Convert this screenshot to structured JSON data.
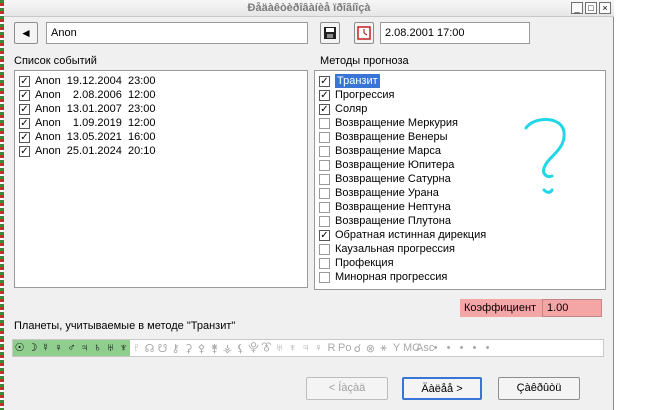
{
  "window": {
    "title": "Ðåäàêòèðîâàíèå ïðîãíîçà",
    "minimize": "_",
    "maximize": "□",
    "close": "×"
  },
  "toolbar": {
    "arrow_glyph": "◄",
    "name_value": "Anon",
    "datetime_value": "2.08.2001    17:00"
  },
  "events": {
    "label": "Список событий",
    "items": [
      {
        "text": "Anon  19.12.2004  23:00",
        "checked": true
      },
      {
        "text": "Anon    2.08.2006  12:00",
        "checked": true
      },
      {
        "text": "Anon  13.01.2007  23:00",
        "checked": true
      },
      {
        "text": "Anon    1.09.2019  12:00",
        "checked": true
      },
      {
        "text": "Anon  13.05.2021  16:00",
        "checked": true
      },
      {
        "text": "Anon  25.01.2024  20:10",
        "checked": true
      }
    ]
  },
  "methods": {
    "label": "Методы прогноза",
    "items": [
      {
        "text": "Транзит",
        "checked": true,
        "selected": true
      },
      {
        "text": "Прогрессия",
        "checked": true
      },
      {
        "text": "Соляр",
        "checked": true
      },
      {
        "text": "Возвращение Меркурия",
        "checked": false
      },
      {
        "text": "Возвращение Венеры",
        "checked": false
      },
      {
        "text": "Возвращение Марса",
        "checked": false
      },
      {
        "text": "Возвращение Юпитера",
        "checked": false
      },
      {
        "text": "Возвращение Сатурна",
        "checked": false
      },
      {
        "text": "Возвращение Урана",
        "checked": false
      },
      {
        "text": "Возвращение Нептуна",
        "checked": false
      },
      {
        "text": "Возвращение Плутона",
        "checked": false
      },
      {
        "text": "Обратная истинная дирекция",
        "checked": true
      },
      {
        "text": "Каузальная прогрессия",
        "checked": false
      },
      {
        "text": "Профекция",
        "checked": false
      },
      {
        "text": "Минорная прогрессия",
        "checked": false
      }
    ]
  },
  "coefficient": {
    "label": "Коэффициент",
    "value": "1.00"
  },
  "planets": {
    "label": "Планеты, учитываемые в методе \"Транзит\"",
    "glyphs_on": [
      "☉",
      "☽",
      "☿",
      "♀",
      "♂",
      "♃",
      "♄",
      "♅",
      "♆"
    ],
    "glyphs_off": [
      "♇",
      "☊",
      "☋",
      "⚷",
      "⚳",
      "⚴",
      "⚵",
      "⚶",
      "⚸",
      "⯓",
      "⯔",
      "♅",
      "♆",
      "♃",
      "♀",
      "R",
      "Po",
      "☌",
      "⊗",
      "⚹",
      "Y",
      "MC",
      "Asc",
      "•",
      "•",
      "•",
      "•",
      "•"
    ]
  },
  "buttons": {
    "back": "< Íàçàä",
    "next": "Äàëåå >",
    "cancel": "Çàêðûòü"
  },
  "annotation": {
    "color": "#22d6e6"
  }
}
